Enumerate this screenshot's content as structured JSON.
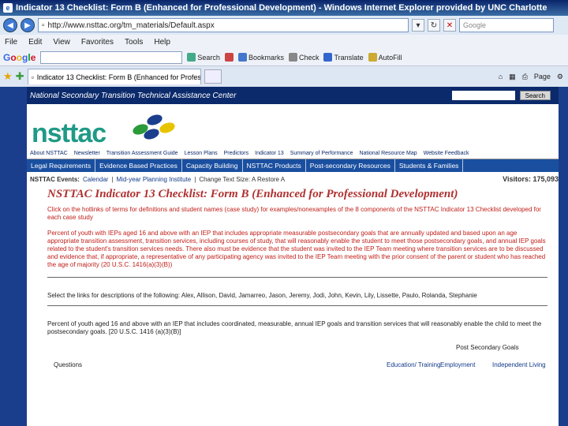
{
  "window": {
    "title": "Indicator 13 Checklist: Form B (Enhanced for Professional Development) - Windows Internet Explorer provided by UNC Charlotte"
  },
  "address": {
    "url": "http://www.nsttac.org/tm_materials/Default.aspx",
    "search_placeholder": "Google"
  },
  "menu": {
    "items": [
      "File",
      "Edit",
      "View",
      "Favorites",
      "Tools",
      "Help"
    ]
  },
  "google_toolbar": {
    "logo": [
      "G",
      "o",
      "o",
      "g",
      "l",
      "e"
    ],
    "items": [
      "Search",
      "Bookmarks",
      "Check",
      "Translate",
      "AutoFill"
    ]
  },
  "tabs": {
    "active": "Indicator 13 Checklist: Form B (Enhanced for Professi...",
    "right_items": [
      "Page"
    ]
  },
  "site": {
    "org_name": "National Secondary Transition Technical Assistance Center",
    "search_button": "Search",
    "logo": "nsttac",
    "main_nav": [
      "About NSTTAC",
      "Newsletter",
      "Transition Assessment Guide",
      "Lesson Plans",
      "Predictors",
      "Indicator 13",
      "Summary of Performance",
      "National Resource Map",
      "Website Feedback"
    ],
    "sec_nav": [
      "Legal Requirements",
      "Evidence Based Practices",
      "Capacity Building",
      "NSTTAC Products",
      "Post-secondary Resources",
      "Students & Families"
    ],
    "events_label": "NSTTAC Events:",
    "events": [
      "Calendar",
      "Mid-year Planning Institute"
    ],
    "text_size": "Change Text Size: A  Restore A",
    "visitors": "Visitors: 175,093"
  },
  "content": {
    "title": "NSTTAC Indicator 13 Checklist: Form B (Enhanced for Professional Development)",
    "intro": "Click on the hotlinks of terms for definitions and student names (case study) for examples/nonexamples of the 8 components of the NSTTAC Indicator 13 Checklist developed for each case study",
    "para1": "Percent of youth with IEPs aged 16 and above with an IEP that includes appropriate measurable postsecondary goals that are annually updated and based upon an age appropriate transition assessment, transition services, including courses of study, that will reasonably enable the student to meet those postsecondary goals, and annual IEP goals related to the student's transition services needs. There also must be evidence that the student was invited to the IEP Team meeting where transition services are to be discussed and evidence that, if appropriate, a representative of any participating agency was invited to the IEP Team meeting with the prior consent of the parent or student who has reached the age of majority (20 U.S.C. 1416(a)(3)(B))",
    "names_line": "Select the links for descriptions of the following: Alex, Allison, David, Jamarreo, Jason, Jeremy, Jodi, John, Kevin, Lily, Lissette, Paulo, Rolanda, Stephanie",
    "para2": "Percent of youth aged 16 and above with an IEP that includes coordinated, measurable, annual IEP goals and transition services that will reasonably enable the child to meet the postsecondary goals. [20 U.S.C. 1416 (a)(3)(B)]",
    "table": {
      "group_header": "Post Secondary Goals",
      "questions": "Questions",
      "cols": [
        "Education/ Training",
        "Employment",
        "Independent Living"
      ]
    }
  }
}
